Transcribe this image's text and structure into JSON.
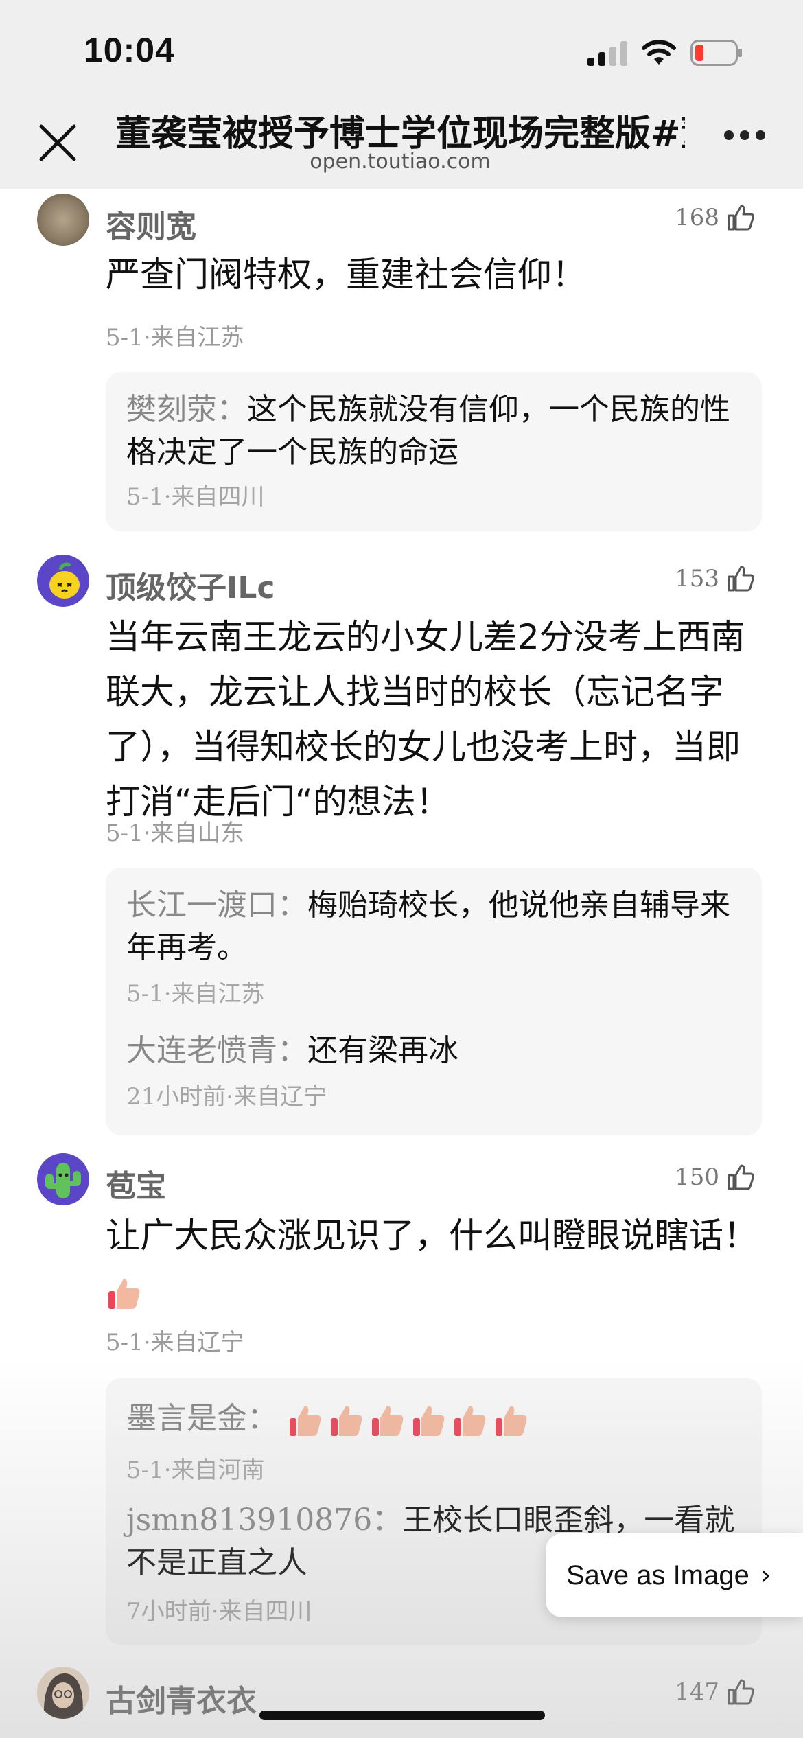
{
  "status_bar": {
    "time": "10:04"
  },
  "nav": {
    "title": "董袭莹被授予博士学位现场完整版#董",
    "subtitle": "open.toutiao.com"
  },
  "comments": [
    {
      "name": "容则宽",
      "likes": "168",
      "text": "严查门阀特权，重建社会信仰！",
      "meta": "5-1·来自江苏",
      "replies": [
        {
          "name": "樊刻荥：",
          "text": "这个民族就没有信仰，一个民族的性格决定了一个民族的命运",
          "meta": "5-1·来自四川"
        }
      ]
    },
    {
      "name": "顶级饺子ILc",
      "likes": "153",
      "text": "当年云南王龙云的小女儿差2分没考上西南联大，龙云让人找当时的校长（忘记名字了），当得知校长的女儿也没考上时，当即打消“走后门“的想法！",
      "meta": "5-1·来自山东",
      "replies": [
        {
          "name": "长江一渡口：",
          "text": "梅贻琦校长，他说他亲自辅导来年再考。",
          "meta": "5-1·来自江苏"
        },
        {
          "name": "大连老愤青：",
          "text": "还有梁再冰",
          "meta": "21小时前·来自辽宁"
        }
      ]
    },
    {
      "name": "苞宝",
      "likes": "150",
      "text": "让广大民众涨见识了，什么叫瞪眼说瞎话！",
      "meta": "5-1·来自辽宁",
      "replies": [
        {
          "name": "墨言是金：",
          "text": "",
          "meta": "5-1·来自河南"
        },
        {
          "name": "jsmn813910876：",
          "text": "王校长口眼歪斜，一看就不是正直之人",
          "meta": "7小时前·来自四川"
        }
      ]
    },
    {
      "name": "古剑青衣衣",
      "likes": "147"
    }
  ],
  "save_button": {
    "label": "Save as Image"
  },
  "colors": {
    "thumb": "#f2b8a0",
    "thumb_cuff": "#e8485a",
    "avatar_green": "#5fc25b",
    "avatar_purple": "#5b46c7"
  }
}
